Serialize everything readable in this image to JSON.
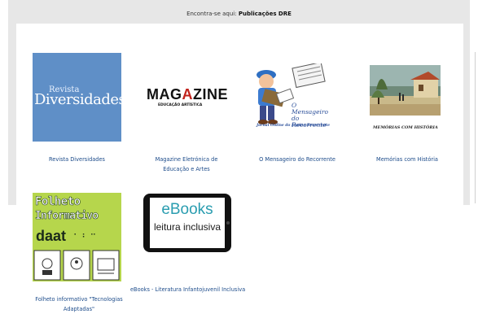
{
  "breadcrumb": {
    "prefix": "Encontra-se aqui:",
    "current": "Publicações DRE"
  },
  "publications": [
    {
      "caption": "Revista Diversidades",
      "thumb": {
        "small": "Revista",
        "big": "Diversidades"
      }
    },
    {
      "caption": "Magazine Eletrónica de Educação e Artes",
      "thumb": {
        "title_a": "MAG",
        "title_red": "A",
        "title_b": "ZINE",
        "sub": "EDUCAÇÃO ARTÍSTICA"
      }
    },
    {
      "caption": "O Mensageiro do Recorrente",
      "thumb": {
        "title": "O Mensageiro do Recorrente",
        "sub": "Jornal Online do Ensino Recorrente"
      }
    },
    {
      "caption": "Memórias com História",
      "thumb": {
        "sub": "MEMÓRIAS COM HISTÓRIA"
      }
    },
    {
      "caption": "Folheto informativo \"Tecnologias Adaptadas\"",
      "thumb": {
        "line1": "Folheto",
        "line2": "Informativo",
        "logo": "daat"
      }
    },
    {
      "caption": "eBooks - Literatura Infantojuvenil Inclusiva",
      "thumb": {
        "line1": "eBooks",
        "line2": "leitura inclusiva"
      }
    }
  ]
}
